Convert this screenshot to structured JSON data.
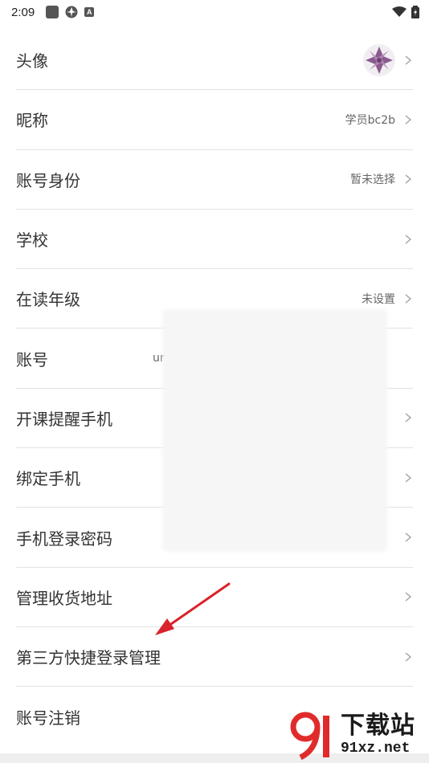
{
  "status_bar": {
    "time": "2:09"
  },
  "rows": [
    {
      "label": "头像",
      "value": "",
      "has_avatar": true
    },
    {
      "label": "昵称",
      "value": "学员bc2b"
    },
    {
      "label": "账号身份",
      "value": "暂未选择"
    },
    {
      "label": "学校",
      "value": ""
    },
    {
      "label": "在读年级",
      "value": "未设置"
    },
    {
      "label": "账号",
      "value": ""
    },
    {
      "label": "开课提醒手机",
      "value": ""
    },
    {
      "label": "绑定手机",
      "value": ""
    },
    {
      "label": "手机登录密码",
      "value": ""
    },
    {
      "label": "管理收货地址",
      "value": ""
    },
    {
      "label": "第三方快捷登录管理",
      "value": ""
    },
    {
      "label": "账号注销",
      "value": ""
    }
  ],
  "account_peek": "ur",
  "watermark": {
    "top": "下载站",
    "bottom": "91xz.net"
  },
  "colors": {
    "arrow": "#d9232b",
    "watermark_red": "#e02b2b",
    "divider": "#e2e2e2"
  }
}
